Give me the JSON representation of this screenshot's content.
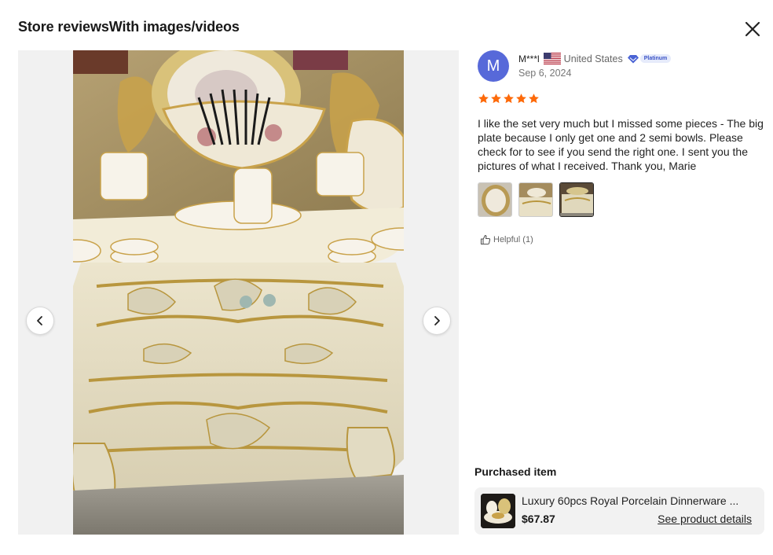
{
  "modal": {
    "title": "Store reviewsWith images/videos"
  },
  "review": {
    "avatar_letter": "M",
    "username": "M***l",
    "country": "United States",
    "tier": "Platinum",
    "date": "Sep 6, 2024",
    "rating": 5,
    "text": "I like the set very much but I missed some pieces - The big plate because I only get one and 2 semi bowls. Please check for to see if you send the right one. I sent you the pictures of what I received. Thank you, Marie",
    "helpful_label": "Helpful (1)",
    "image_count": 3,
    "selected_image": 3
  },
  "purchased": {
    "label": "Purchased item",
    "product_name": "Luxury 60pcs Royal Porcelain Dinnerware ...",
    "price": "$67.87",
    "details_link": "See product details"
  },
  "icons": {
    "close": "close-icon",
    "prev": "chevron-left-icon",
    "next": "chevron-right-icon",
    "flag": "us-flag-icon",
    "tier": "diamond-icon",
    "star": "star-icon",
    "helpful": "thumbs-up-icon"
  },
  "colors": {
    "star": "#fd6a0a",
    "avatar": "#5769d9",
    "tier_badge": "#3a52c6",
    "card_bg": "#f2f2f2"
  }
}
